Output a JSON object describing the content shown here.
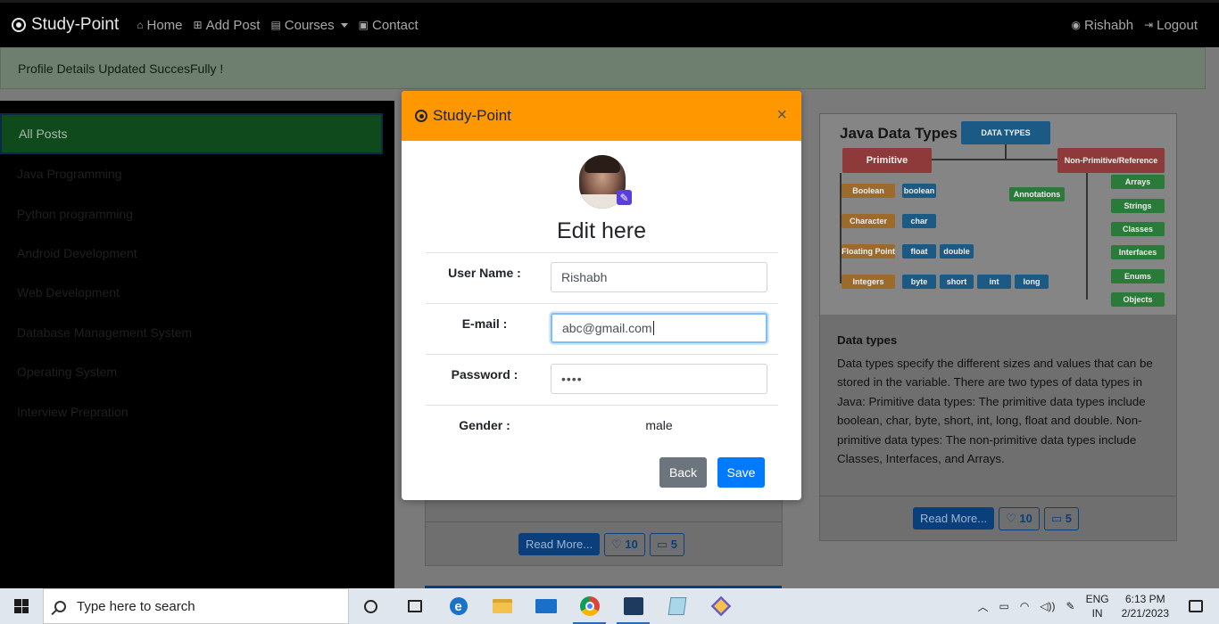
{
  "navbar": {
    "brand": "Study-Point",
    "items": [
      {
        "label": "Home",
        "icon": "home-icon"
      },
      {
        "label": "Add Post",
        "icon": "plus-square-icon"
      },
      {
        "label": "Courses",
        "icon": "book-icon"
      },
      {
        "label": "Contact",
        "icon": "contact-card-icon"
      }
    ],
    "user": "Rishabh",
    "logout": "Logout"
  },
  "alert": {
    "text": "Profile Details Updated SuccesFully !"
  },
  "sidebar": {
    "items": [
      {
        "label": "All Posts"
      },
      {
        "label": "Java Programming"
      },
      {
        "label": "Python programming"
      },
      {
        "label": "Android Development"
      },
      {
        "label": "Web Development"
      },
      {
        "label": "Database Management System"
      },
      {
        "label": "Operating System"
      },
      {
        "label": "Interview Prepration"
      }
    ]
  },
  "post_right": {
    "image": {
      "title": "Java Data Types",
      "root": "DATA TYPES",
      "primitive": "Primitive",
      "non_primitive": "Non-Primitive/Reference",
      "boolean_group": "Boolean",
      "boolean": "boolean",
      "character_group": "Character",
      "char": "char",
      "floating_group": "Floating Point",
      "float": "float",
      "double": "double",
      "integers_group": "Integers",
      "byte": "byte",
      "short": "short",
      "int": "int",
      "long": "long",
      "annotations": "Annotations",
      "arrays": "Arrays",
      "strings": "Strings",
      "classes": "Classes",
      "interfaces": "Interfaces",
      "enums": "Enums",
      "objects": "Objects"
    },
    "title": "Data types",
    "body": "Data types specify the different sizes and values that can be stored in the variable. There are two types of data types in Java: Primitive data types: The primitive data types include boolean, char, byte, short, int, long, float and double. Non-primitive data types: The non-primitive data types include Classes, Interfaces, and Arrays.",
    "read_more": "Read More...",
    "likes": "10",
    "comments": "5"
  },
  "post_left": {
    "read_more": "Read More...",
    "likes": "10",
    "comments": "5"
  },
  "modal": {
    "title": "Study-Point",
    "close": "×",
    "heading": "Edit here",
    "fields": {
      "username_label": "User Name :",
      "username_value": "Rishabh",
      "email_label": "E-mail :",
      "email_value": "abc@gmail.com",
      "password_label": "Password :",
      "password_value": "••••",
      "gender_label": "Gender :",
      "gender_value": "male"
    },
    "back": "Back",
    "save": "Save"
  },
  "taskbar": {
    "search_placeholder": "Type here to search",
    "apps": [
      "cortana-icon",
      "task-view-icon",
      "edge-icon",
      "file-explorer-icon",
      "mail-icon",
      "chrome-icon",
      "netbeans-icon",
      "notepad-icon",
      "virtualbox-icon"
    ],
    "lang_top": "ENG",
    "lang_bottom": "IN",
    "time": "6:13 PM",
    "date": "2/21/2023"
  }
}
